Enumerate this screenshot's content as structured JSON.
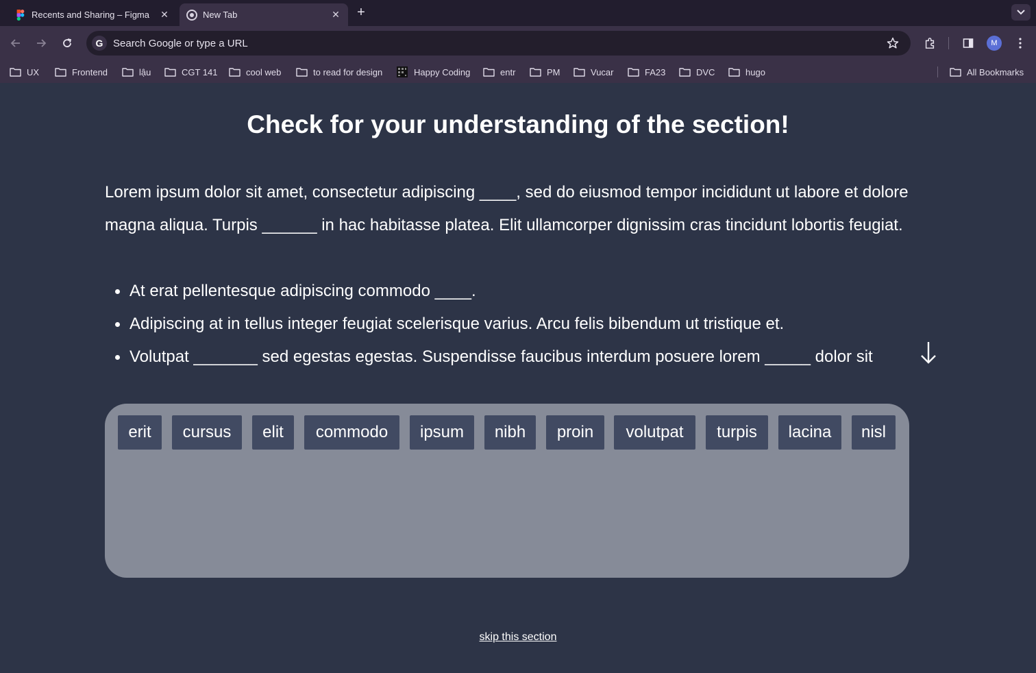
{
  "browser": {
    "tabs": [
      {
        "title": "Recents and Sharing – Figma",
        "icon": "figma-icon",
        "active": false
      },
      {
        "title": "New Tab",
        "icon": "chrome-icon",
        "active": true
      }
    ],
    "omnibox": {
      "text": "Search Google or type a URL"
    },
    "profile_initial": "M",
    "bookmarks": [
      "UX",
      "Frontend",
      "lậu",
      "CGT 141",
      "cool web",
      "to read for design",
      "Happy Coding",
      "entr",
      "PM",
      "Vucar",
      "FA23",
      "DVC",
      "hugo"
    ],
    "all_bookmarks": "All Bookmarks"
  },
  "page": {
    "heading": "Check for your understanding of the section!",
    "paragraph": "Lorem ipsum dolor sit amet, consectetur adipiscing ____, sed do eiusmod  tempor incididunt ut labore et dolore magna aliqua. Turpis ______ in hac  habitasse platea. Elit ullamcorper dignissim cras tincidunt lobortis  feugiat.",
    "bullets": [
      "At erat pellentesque adipiscing commodo ____.",
      "Adipiscing at in tellus integer feugiat scelerisque varius. Arcu felis bibendum ut tristique et.",
      "Volutpat _______ sed egestas egestas. Suspendisse faucibus interdum  posuere lorem _____ dolor sit"
    ],
    "word_bank": [
      "erit",
      "cursus",
      "elit",
      "commodo",
      "ipsum",
      "nibh",
      "proin",
      "volutpat",
      "turpis",
      "lacina",
      "nisl"
    ],
    "skip_link": "skip this section"
  },
  "colors": {
    "page_bg": "#2d3447",
    "word_bank_bg": "#868b98",
    "chip_bg": "#414a62",
    "chrome_bg": "#3a3147",
    "tabstrip_bg": "#221d2e"
  }
}
